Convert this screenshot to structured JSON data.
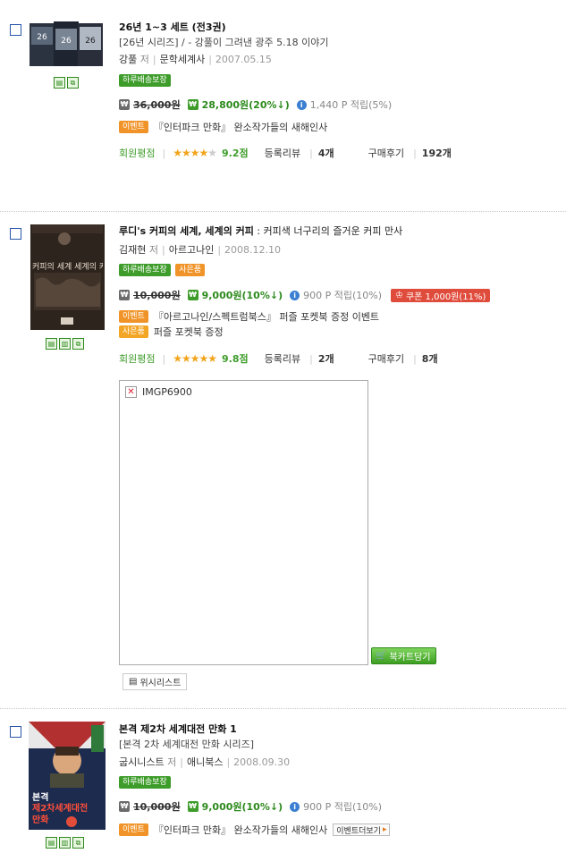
{
  "items": [
    {
      "title": "26년 1~3 세트 (전3권)",
      "subtitle": "",
      "series": "[26년 시리즈] / - 강풀이 그려낸 광주 5.18 이야기",
      "author": "강풀",
      "author_label": "저",
      "publisher": "문학세계사",
      "date": "2007.05.15",
      "tags": [
        "하루배송보장"
      ],
      "orig_price": "36,000원",
      "sale_price": "28,800원(20%↓)",
      "points": "1,440 P 적립(5%)",
      "event_tag": "이벤트",
      "event_text": "『인터파크 만화』 완소작가들의 새해인사",
      "rating_label": "회원평점",
      "stars": 4,
      "score": "9.2점",
      "review_label": "등록리뷰",
      "review_count": "4개",
      "buy_label": "구매후기",
      "buy_count": "192개"
    },
    {
      "title": "루디's 커피의 세계, 세계의 커피",
      "subtitle": ": 커피색 너구리의 즐거운 커피 만사",
      "author": "김재현",
      "author_label": "저",
      "publisher": "아르고나인",
      "date": "2008.12.10",
      "tags": [
        "하루배송보장",
        "사은품"
      ],
      "orig_price": "10,000원",
      "sale_price": "9,000원(10%↓)",
      "points": "900 P 적립(10%)",
      "coupon": "쿠폰 1,000원(11%)",
      "event_tag": "이벤트",
      "event_text": "『아르고나인/스펙트럼북스』 퍼즐 포켓북 증정 이벤트",
      "gift_tag": "사은품",
      "gift_text": "퍼즐 포켓북 증정",
      "rating_label": "회원평점",
      "stars": 5,
      "score": "9.8점",
      "review_label": "등록리뷰",
      "review_count": "2개",
      "buy_label": "구매후기",
      "buy_count": "8개",
      "image_alt": "IMGP6900",
      "cart_label": "북카트담기",
      "wish_label": "위시리스트"
    },
    {
      "title": "본격 제2차 세계대전 만화 1",
      "series": "[본격 2차 세계대전 만화 시리즈]",
      "author": "굽시니스트",
      "author_label": "저",
      "publisher": "애니북스",
      "date": "2008.09.30",
      "tags": [
        "하루배송보장"
      ],
      "orig_price": "10,000원",
      "sale_price": "9,000원(10%↓)",
      "points": "900 P 적립(10%)",
      "event_tag": "이벤트",
      "event_text": "『인터파크 만화』 완소작가들의 새해인사",
      "event_more": "이벤트더보기"
    }
  ],
  "cover_texts": {
    "book2": "커피의 세계 세계의 커피",
    "book3_line1": "본격",
    "book3_line2": "제2차세계대전",
    "book3_line3": "만화"
  },
  "colors": {
    "green": "#3e9c2a",
    "orange": "#f09429",
    "coupon_red": "#e04c3c",
    "link_blue": "#2a56a8"
  }
}
